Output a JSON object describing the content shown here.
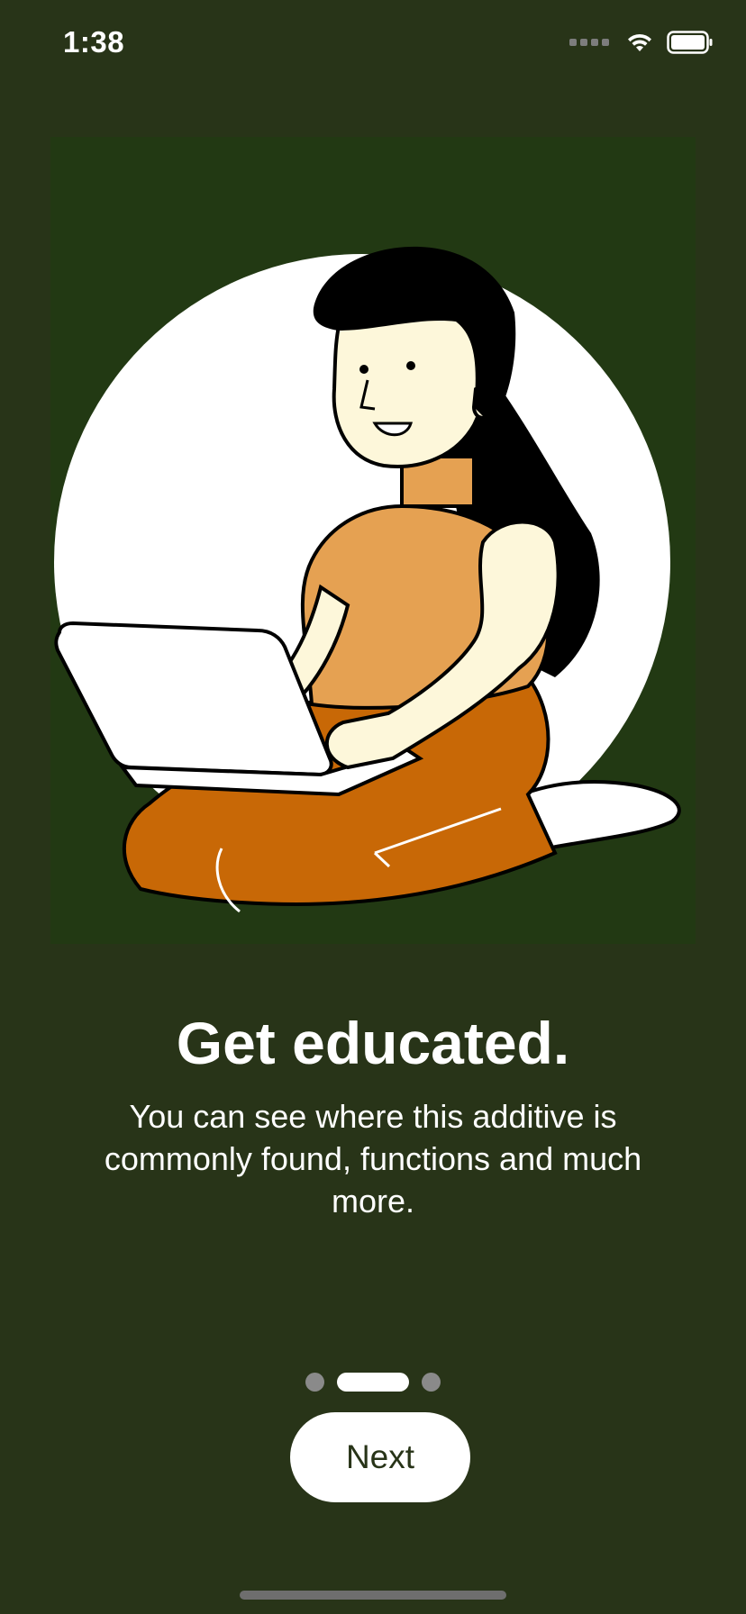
{
  "status_bar": {
    "time": "1:38",
    "icons": [
      "signal-icon",
      "wifi-icon",
      "battery-icon"
    ]
  },
  "illustration": {
    "icon": "woman-with-laptop-illustration",
    "colors": {
      "background": "#223913",
      "circle": "#ffffff",
      "top": "#E5A152",
      "pants": "#C86806",
      "skin": "#FDF7DA",
      "hair": "#000000"
    }
  },
  "onboarding": {
    "title": "Get educated.",
    "description": "You can see where this additive is commonly found, functions and much more."
  },
  "pager": {
    "total_pages": 3,
    "current_page": 2
  },
  "next_button": {
    "label": "Next"
  },
  "colors": {
    "background": "#283418",
    "button_bg": "#ffffff",
    "button_text": "#283418",
    "dot_inactive": "#8a8a8a",
    "dot_active": "#ffffff"
  }
}
